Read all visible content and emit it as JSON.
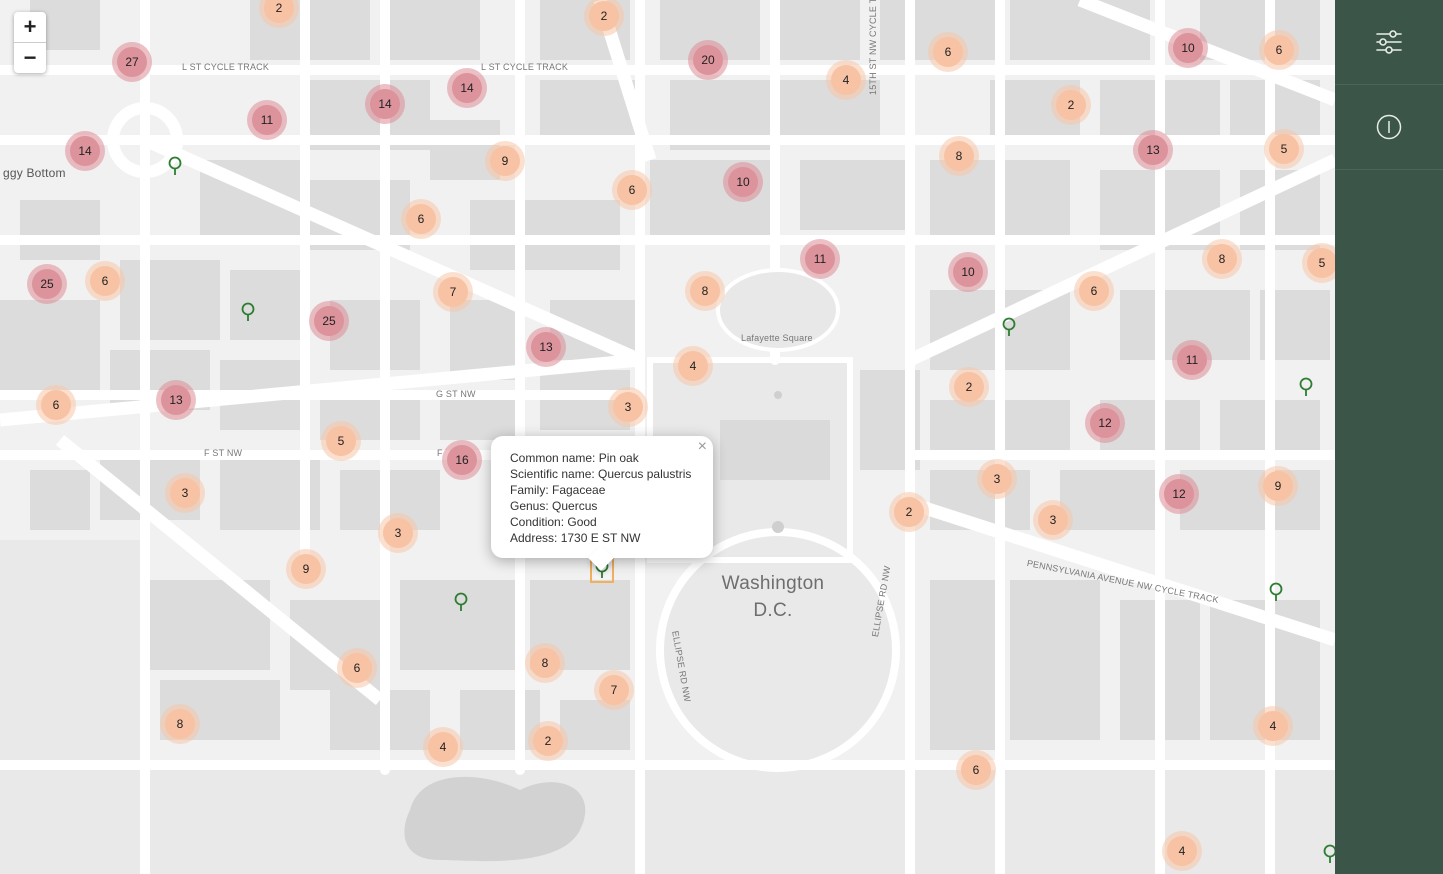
{
  "map": {
    "zoom_in_label": "+",
    "zoom_out_label": "−",
    "labels": {
      "city": "Washington\nD.C.",
      "foggy_bottom": "ggy Bottom",
      "lafayette": "Lafayette Square",
      "l_st_track_west": "L ST CYCLE TRACK",
      "l_st_track_east": "L ST CYCLE TRACK",
      "g_st": "G ST NW",
      "f_st": "F ST NW",
      "f_st_partial": "F",
      "penn_track": "PENNSYLVANIA AVENUE NW CYCLE TRACK",
      "ellipse_w": "ELLIPSE RD NW",
      "ellipse_e": "ELLIPSE RD NW",
      "fifteenth": "15TH ST NW CYCLE T"
    },
    "clusters": [
      "2",
      "2",
      "27",
      "14",
      "14",
      "11",
      "14",
      "9",
      "6",
      "20",
      "10",
      "4",
      "6",
      "2",
      "10",
      "6",
      "13",
      "5",
      "8",
      "6",
      "25",
      "6",
      "7",
      "13",
      "8",
      "4",
      "11",
      "10",
      "6",
      "8",
      "5",
      "25",
      "6",
      "2",
      "11",
      "13",
      "3",
      "5",
      "16",
      "12",
      "3",
      "3",
      "3",
      "2",
      "12",
      "9",
      "9",
      "3",
      "6",
      "8",
      "7",
      "4",
      "2",
      "8",
      "6",
      "4",
      "4"
    ],
    "tree_icon": "tree-icon"
  },
  "popup": {
    "common_name": "Common name: Pin oak",
    "scientific_name": "Scientific name: Quercus palustris",
    "family": "Family: Fagaceae",
    "genus": "Genus: Quercus",
    "condition": "Condition: Good",
    "address": "Address: 1730 E ST NW",
    "close_label": "×"
  },
  "sidebar": {
    "filter_icon": "sliders-icon",
    "info_icon": "info-icon"
  },
  "colors": {
    "sidebar": "#3b5648",
    "cluster_small": "#f8c2a4",
    "cluster_big": "#dc939c",
    "tree_marker": "#2e7d32"
  }
}
